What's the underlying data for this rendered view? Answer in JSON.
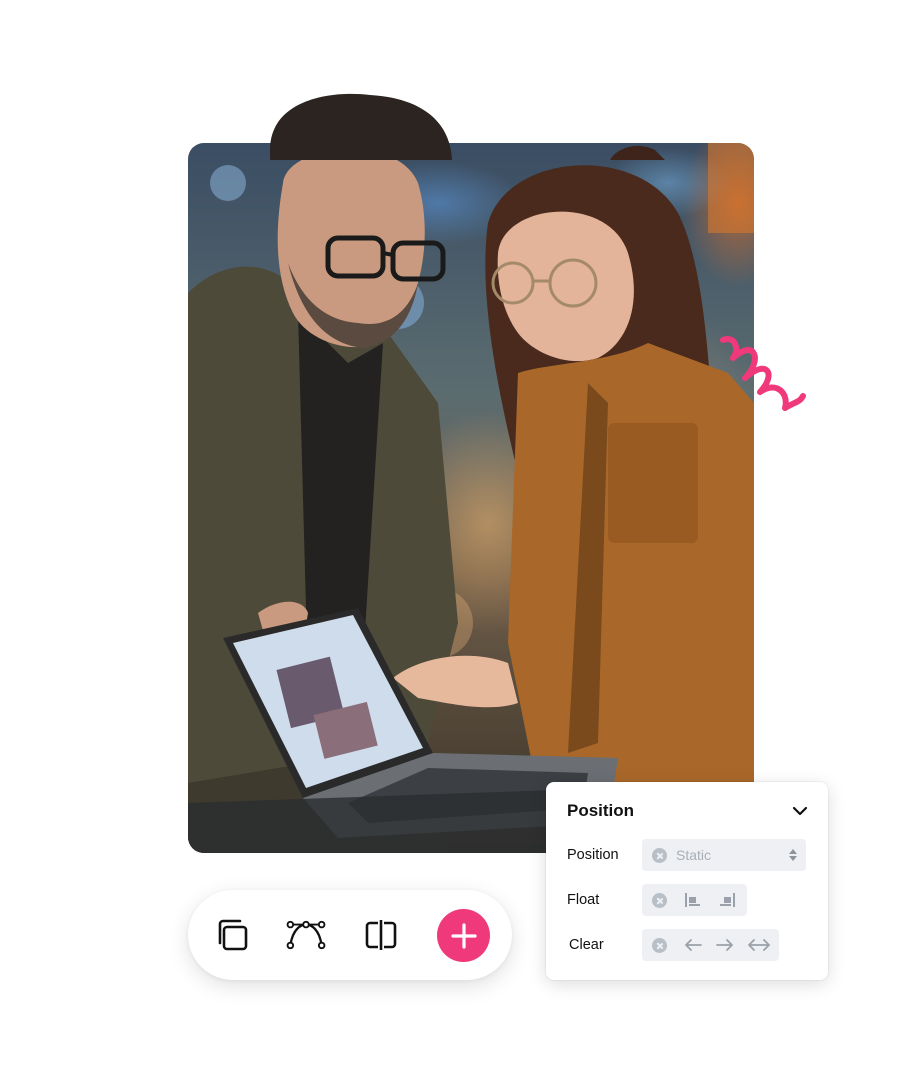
{
  "colors": {
    "accent": "#f0397a",
    "panel_control_bg": "#eef0f3",
    "muted_icon": "#b9bfc7"
  },
  "toolbar": {
    "tools": [
      {
        "icon": "copy-icon"
      },
      {
        "icon": "bezier-curve-icon"
      },
      {
        "icon": "split-view-icon"
      }
    ],
    "add_icon": "plus-icon"
  },
  "panel": {
    "title": "Position",
    "collapse_icon": "chevron-down-icon",
    "rows": {
      "position": {
        "label": "Position",
        "value": "Static"
      },
      "float": {
        "label": "Float",
        "options": [
          "float-left-icon",
          "float-right-icon"
        ]
      },
      "clear": {
        "label": "Clear",
        "options": [
          "arrow-left-icon",
          "arrow-right-icon",
          "arrow-both-icon"
        ]
      }
    }
  }
}
